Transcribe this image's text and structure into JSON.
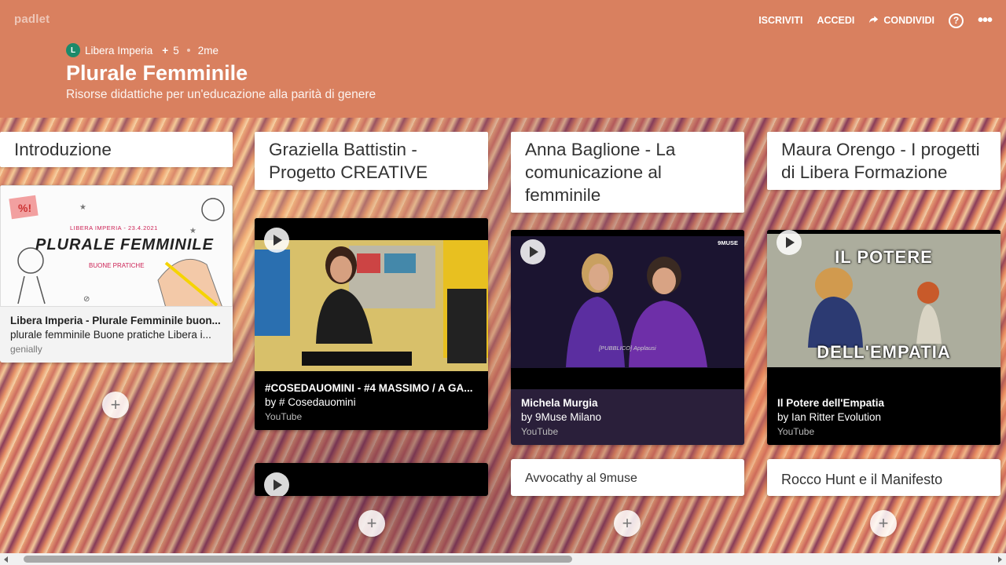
{
  "app": {
    "logo": "padlet"
  },
  "nav": {
    "subscribe": "ISCRIVITI",
    "login": "ACCEDI",
    "share": "CONDIVIDI",
    "help": "?",
    "more": "•••"
  },
  "board": {
    "author_initial": "L",
    "author": "Libera Imperia",
    "plus_count": "5",
    "age": "2me",
    "title": "Plurale Femminile",
    "subtitle": "Risorse didattiche per un'educazione alla parità di genere"
  },
  "columns": [
    {
      "title": "Introduzione",
      "cards": [
        {
          "thumb_heading": "PLURALE FEMMINILE",
          "thumb_date": "LIBERA IMPERIA - 23.4.2021",
          "thumb_sub": "BUONE PRATICHE",
          "title": "Libera Imperia - Plurale Femminile buon...",
          "desc": "plurale femminile Buone pratiche Libera i...",
          "source": "genially"
        }
      ]
    },
    {
      "title": "Graziella Battistin - Progetto CREATIVE",
      "cards": [
        {
          "title": "#COSEDAUOMINI - #4 MASSIMO / A GA...",
          "desc": "by # Cosedauomini",
          "source": "YouTube"
        }
      ]
    },
    {
      "title": "Anna Baglione - La comunicazione al femminile",
      "cards": [
        {
          "thumb_badge": "9MUSE",
          "thumb_caption": "[PUBBLICO] Applausi",
          "title": "Michela Murgia",
          "desc": "by 9Muse Milano",
          "source": "YouTube"
        },
        {
          "title": "Avvocathy al 9muse"
        }
      ]
    },
    {
      "title": "Maura Orengo - I progetti di Libera Formazione",
      "cards": [
        {
          "thumb_top": "IL POTERE",
          "thumb_bottom": "DELL'EMPATIA",
          "title": "Il Potere dell'Empatia",
          "desc": "by Ian Ritter Evolution",
          "source": "YouTube"
        },
        {
          "title": "Rocco Hunt e il Manifesto"
        }
      ]
    }
  ],
  "add_label": "+"
}
